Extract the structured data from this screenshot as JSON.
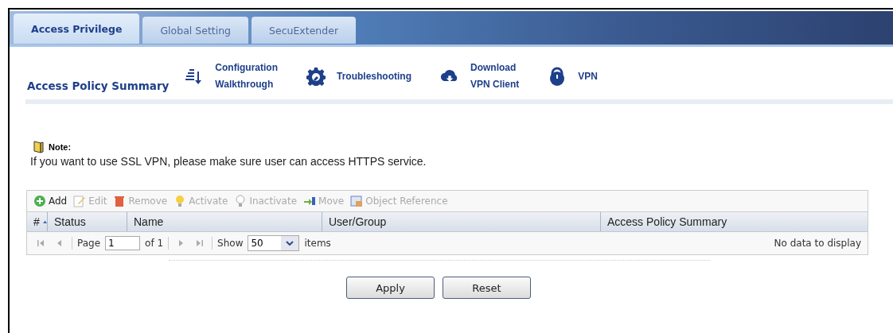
{
  "tabs": [
    {
      "label": "Access Privilege",
      "selected": true
    },
    {
      "label": "Global Setting",
      "selected": false
    },
    {
      "label": "SecuExtender",
      "selected": false
    }
  ],
  "section_title": "Access Policy Summary",
  "quick_links": [
    {
      "kind": "walkthrough",
      "lines": [
        "Configuration",
        "Walkthrough"
      ]
    },
    {
      "kind": "troubleshoot",
      "lines": [
        "Troubleshooting"
      ]
    },
    {
      "kind": "download",
      "lines": [
        "Download",
        "VPN Client"
      ]
    },
    {
      "kind": "vpn",
      "lines": [
        "VPN"
      ]
    }
  ],
  "note": {
    "label": "Note:",
    "text": "If you want to use SSL VPN, please make sure user can access HTTPS service."
  },
  "toolbar": [
    {
      "kind": "add",
      "label": "Add",
      "disabled": false
    },
    {
      "kind": "edit",
      "label": "Edit",
      "disabled": true
    },
    {
      "kind": "remove",
      "label": "Remove",
      "disabled": true
    },
    {
      "kind": "activate",
      "label": "Activate",
      "disabled": true
    },
    {
      "kind": "inactivate",
      "label": "Inactivate",
      "disabled": true
    },
    {
      "kind": "move",
      "label": "Move",
      "disabled": true
    },
    {
      "kind": "reference",
      "label": "Object Reference",
      "disabled": true
    }
  ],
  "table": {
    "columns": [
      "#",
      "Status",
      "Name",
      "User/Group",
      "Access Policy Summary"
    ]
  },
  "pager": {
    "page_label": "Page",
    "page": "1",
    "of": "of 1",
    "show_label": "Show",
    "per_page": "50",
    "items_label": "items",
    "empty": "No data to display"
  },
  "buttons": [
    "Apply",
    "Reset"
  ]
}
